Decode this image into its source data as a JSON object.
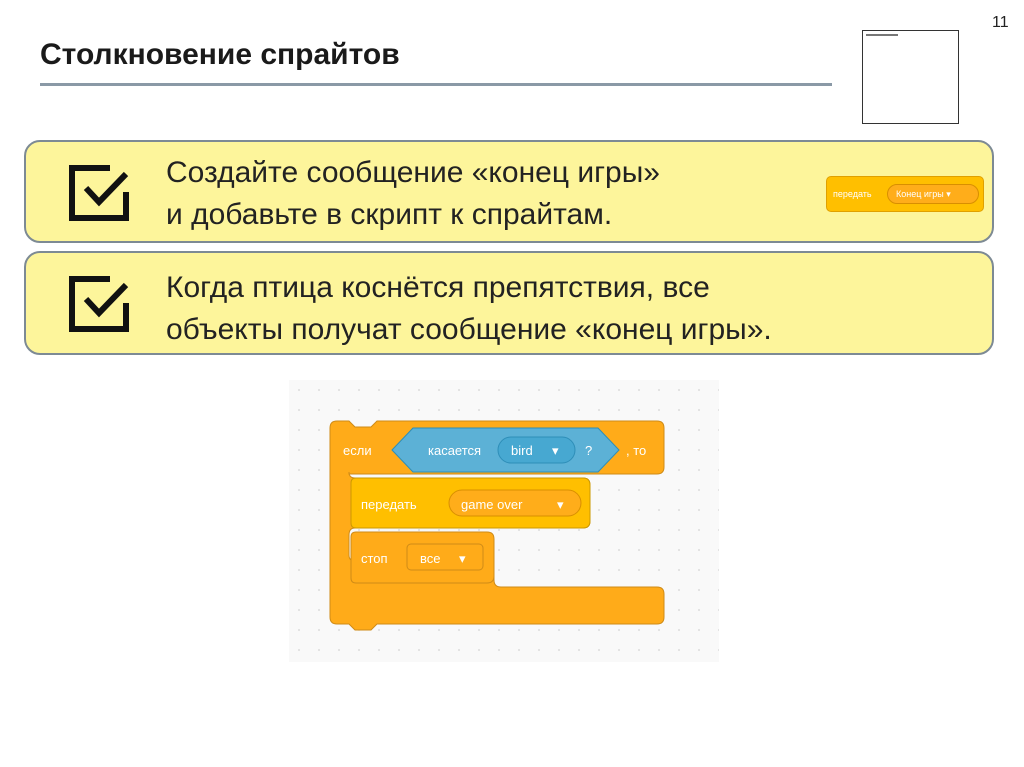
{
  "slide": {
    "page_number": "11",
    "title": "Столкновение спрайтов"
  },
  "panels": [
    {
      "line1": "Создайте сообщение «конец игры»",
      "line2": "и добавьте в скрипт к спрайтам."
    },
    {
      "line1": "Когда птица коснётся препятствия, все",
      "line2": "объекты получат сообщение «конец игры»."
    }
  ],
  "mini_block": {
    "label": "передать",
    "value": "Конец игры"
  },
  "script": {
    "if_label": "если",
    "touching_label": "касается",
    "touching_value": "bird",
    "question": "?",
    "then_label": ", то",
    "broadcast_label": "передать",
    "broadcast_value": "game over",
    "stop_label": "стоп",
    "stop_value": "все"
  },
  "colors": {
    "panel_bg": "#fdf59b",
    "control_orange": "#ffab19",
    "events_yellow": "#ffbf00",
    "sensing_blue": "#5cb1d6"
  }
}
